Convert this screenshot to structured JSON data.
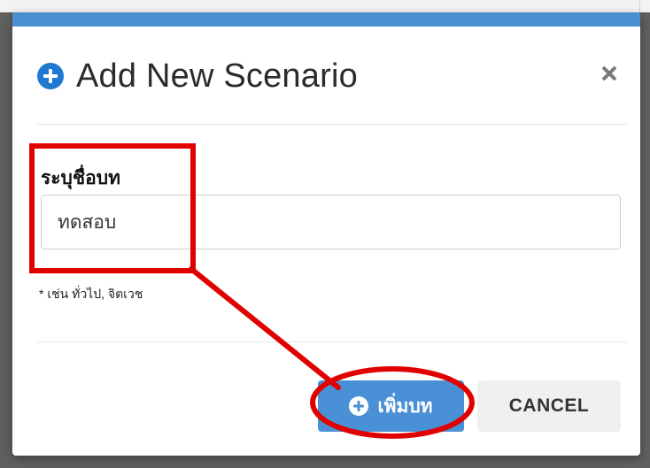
{
  "modal": {
    "title": "Add New Scenario",
    "field_label": "ระบุชื่อบท",
    "input_value": "ทดสอบ",
    "hint": "* เช่น ทั่วไป, จิตเวช",
    "buttons": {
      "add_label": "เพิ่มบท",
      "cancel_label": "CANCEL"
    },
    "icons": {
      "title": "plus-circle-icon",
      "close": "close-icon",
      "add": "plus-circle-icon"
    }
  },
  "colors": {
    "accent_bar": "#4a8fcf",
    "primary_button": "#4a90d6",
    "title_icon": "#1e7ad0",
    "annotation": "#e00000"
  }
}
